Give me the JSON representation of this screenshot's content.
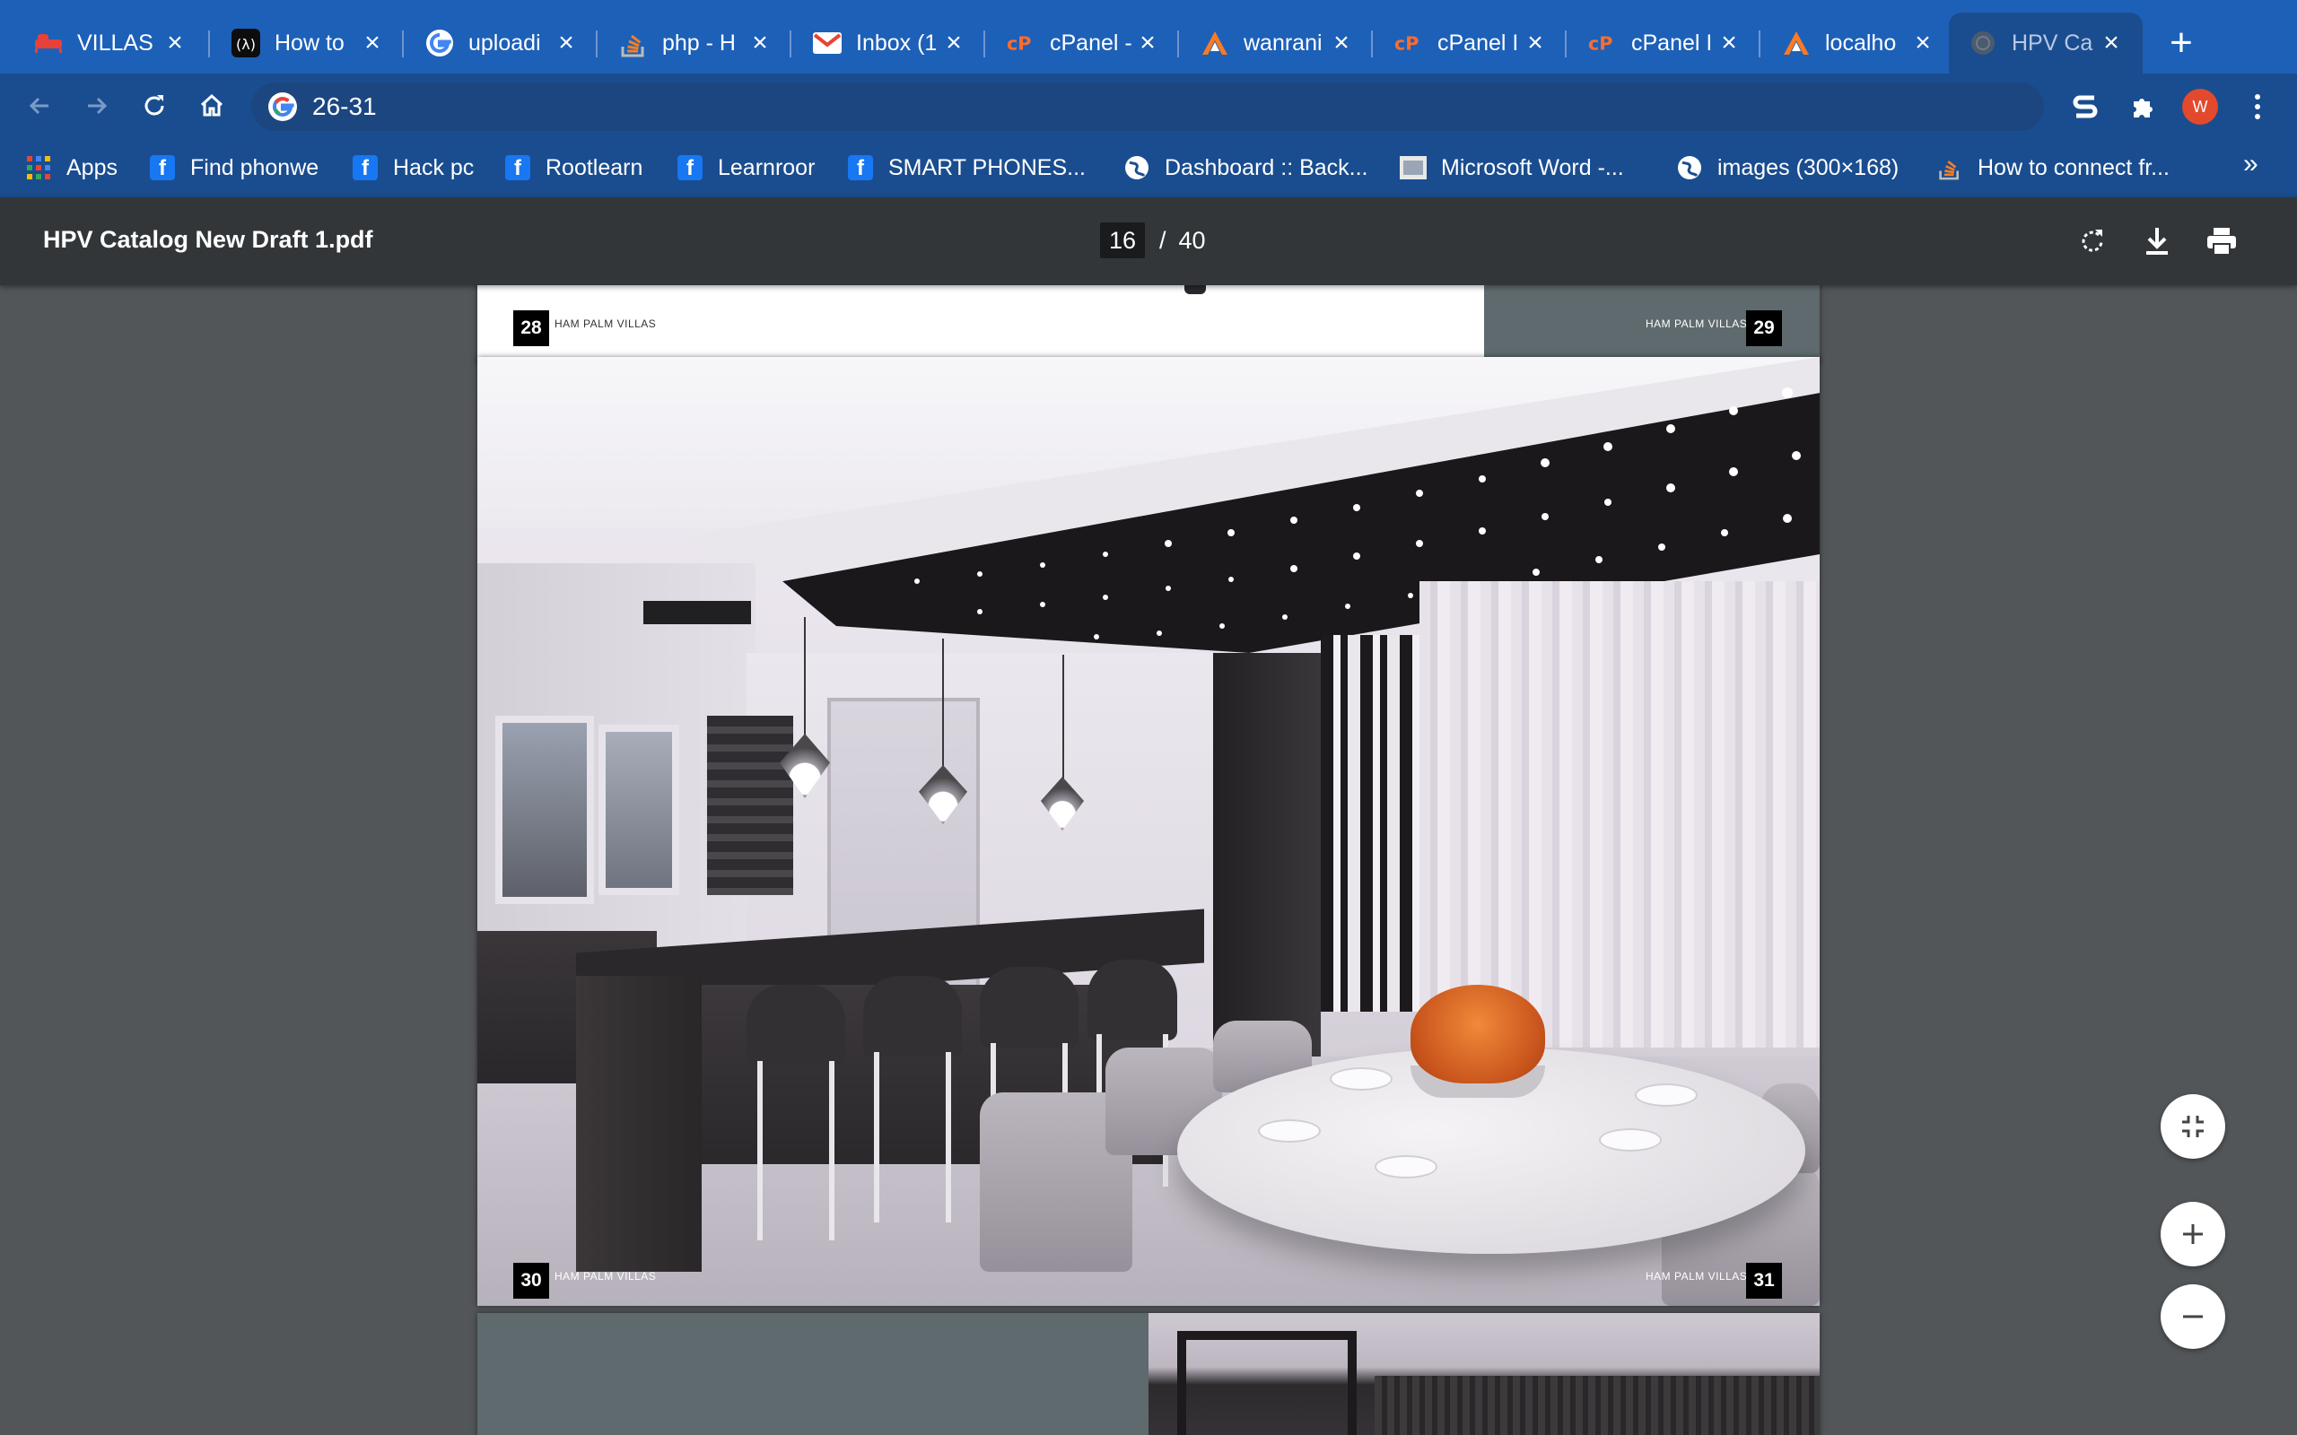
{
  "tabs": [
    {
      "title": "VILLAS",
      "icon": "bed-icon"
    },
    {
      "title": "How to",
      "icon": "codeigniter-icon"
    },
    {
      "title": "uploadi",
      "icon": "google-icon"
    },
    {
      "title": "php - H",
      "icon": "stackoverflow-icon"
    },
    {
      "title": "Inbox (1",
      "icon": "gmail-icon"
    },
    {
      "title": "cPanel -",
      "icon": "cpanel-icon"
    },
    {
      "title": "wanrani",
      "icon": "xampp-icon"
    },
    {
      "title": "cPanel I",
      "icon": "cpanel-icon"
    },
    {
      "title": "cPanel I",
      "icon": "cpanel-icon"
    },
    {
      "title": "localho",
      "icon": "xampp-icon"
    },
    {
      "title": "HPV Ca",
      "icon": "globe-icon",
      "active": true
    }
  ],
  "address_bar": {
    "url": "26-31"
  },
  "profile": {
    "initial": "W",
    "color": "#e3492c"
  },
  "bookmarks": [
    {
      "label": "Apps",
      "icon": "apps-grid-icon"
    },
    {
      "label": "Find phonwe",
      "icon": "facebook-icon"
    },
    {
      "label": "Hack pc",
      "icon": "facebook-icon"
    },
    {
      "label": "Rootlearn",
      "icon": "facebook-icon"
    },
    {
      "label": "Learnroor",
      "icon": "facebook-icon"
    },
    {
      "label": "SMART PHONES...",
      "icon": "facebook-icon"
    },
    {
      "label": "Dashboard :: Back...",
      "icon": "globe-icon"
    },
    {
      "label": "Microsoft Word -...",
      "icon": "document-icon"
    },
    {
      "label": "images (300×168)",
      "icon": "globe-icon"
    },
    {
      "label": "How to connect fr...",
      "icon": "stackoverflow-icon"
    }
  ],
  "bookmarks_more": "»",
  "pdf": {
    "title": "HPV Catalog New Draft 1.pdf",
    "current_page": "16",
    "separator": "/",
    "total_pages": "40"
  },
  "pages": {
    "top_left_number": "28",
    "top_right_number": "29",
    "main_left_number": "30",
    "main_right_number": "31",
    "caption": "HAM PALM VILLAS"
  },
  "colors": {
    "tab_strip": "#1d60b8",
    "toolbar": "#1a4d8f",
    "pdf_toolbar": "#323639",
    "viewer_bg": "#525659"
  }
}
